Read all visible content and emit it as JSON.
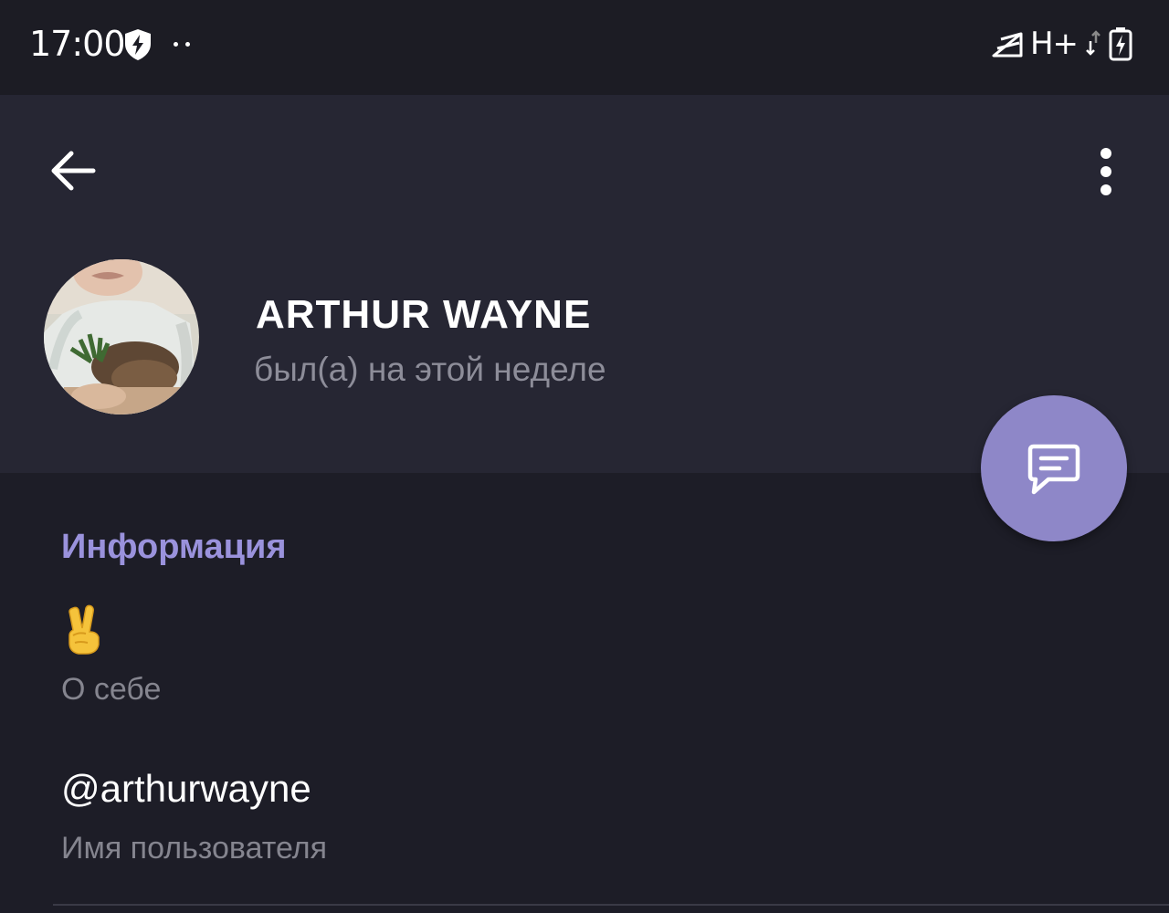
{
  "status_bar": {
    "time": "17:00",
    "network": "H+",
    "icons": [
      "shield-bolt-icon",
      "notification-dots-icon",
      "signal-icon",
      "data-arrows-icon",
      "battery-charging-icon"
    ]
  },
  "header": {
    "back_icon": "arrow-left-icon",
    "menu_icon": "more-vertical-icon",
    "profile": {
      "name": "ARTHUR WAYNE",
      "last_seen": "был(а) на этой неделе"
    }
  },
  "fab": {
    "icon": "message-icon"
  },
  "info": {
    "section_title": "Информация",
    "bio": {
      "value": "✌️",
      "label": "О себе"
    },
    "username": {
      "value": "@arthurwayne",
      "label": "Имя пользователя"
    }
  },
  "colors": {
    "accent": "#9a92dc",
    "fab": "#8e87c8",
    "header_bg": "#262633",
    "page_bg": "#1d1d27",
    "status_bar_bg": "#1c1c24",
    "secondary_text": "#85858f"
  }
}
